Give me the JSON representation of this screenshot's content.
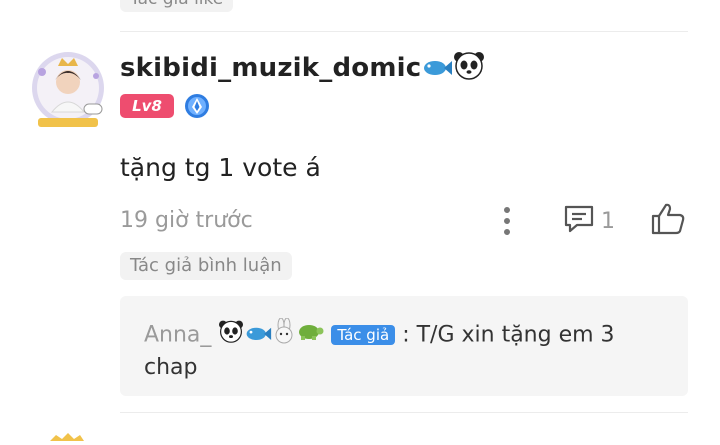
{
  "top_tag": {
    "label": "Tác giả like"
  },
  "comment": {
    "username": "skibidi_muzik_domic",
    "level": "Lv8",
    "text": "tặng tg 1 vote á",
    "time": "19 giờ trước",
    "reply_count": "1",
    "author_tag": "Tác giả bình luận"
  },
  "reply": {
    "author": "Anna_",
    "badge": "Tác giả",
    "text": ": T/G xin tặng em 3 chap"
  },
  "colors": {
    "level_badge": "#ee4d6f",
    "author_badge": "#3b8ee8",
    "rank_badge": "#2f7de1"
  },
  "icons": [
    "fish-icon",
    "panda-icon",
    "rabbit-icon",
    "turtle-icon",
    "more-vertical-icon",
    "comment-icon",
    "like-icon",
    "rank-badge-icon"
  ]
}
